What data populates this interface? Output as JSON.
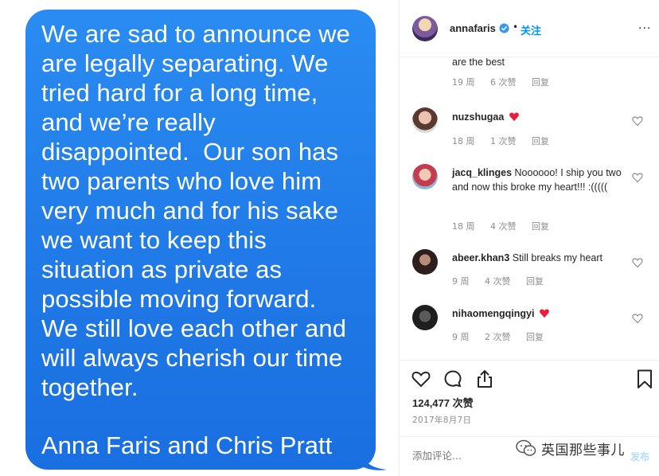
{
  "message": {
    "body": "We are sad to announce we\nare legally separating. We\ntried hard for a long time,\nand we’re really\ndisappointed.  Our son has\ntwo parents who love him\nvery much and for his sake\nwe want to keep this\nsituation as private as\npossible moving forward.\nWe still love each other and\nwill always cherish our time\ntogether.",
    "signature": "Anna Faris and Chris Pratt",
    "bubble_color": "#1f7ee8"
  },
  "header": {
    "username": "annafaris",
    "separator": "•",
    "follow_label": "关注",
    "more_label": "···"
  },
  "comments": [
    {
      "user": "",
      "text": "are the best",
      "age": "19 周",
      "likes": "6 次赞",
      "reply": "回复",
      "partial": true
    },
    {
      "user": "nuzshugaa",
      "text": "",
      "emoji": "heart",
      "age": "18 周",
      "likes": "1 次赞",
      "reply": "回复"
    },
    {
      "user": "jacq_klinges",
      "text": "Noooooo! I ship you two and now this broke my heart!!! :(((((",
      "age": "18 周",
      "likes": "4 次赞",
      "reply": "回复"
    },
    {
      "user": "abeer.khan3",
      "text": "Still breaks my heart",
      "age": "9 周",
      "likes": "4 次赞",
      "reply": "回复"
    },
    {
      "user": "nihaomengqingyi",
      "text": "",
      "emoji": "heart",
      "age": "9 周",
      "likes": "2 次赞",
      "reply": "回复"
    }
  ],
  "stats": {
    "likes": "124,477 次赞",
    "date": "2017年8月7日"
  },
  "add_comment": {
    "placeholder": "添加评论...",
    "post_label": "发布"
  },
  "watermark": {
    "text": "英国那些事儿"
  },
  "colors": {
    "accent": "#0095f6",
    "muted": "#8e8e8e",
    "heart_red": "#ed1c3a"
  },
  "icons": [
    "verified-badge-icon",
    "more-icon",
    "heart-outline-icon",
    "comment-icon",
    "share-icon",
    "bookmark-icon",
    "wechat-icon"
  ]
}
